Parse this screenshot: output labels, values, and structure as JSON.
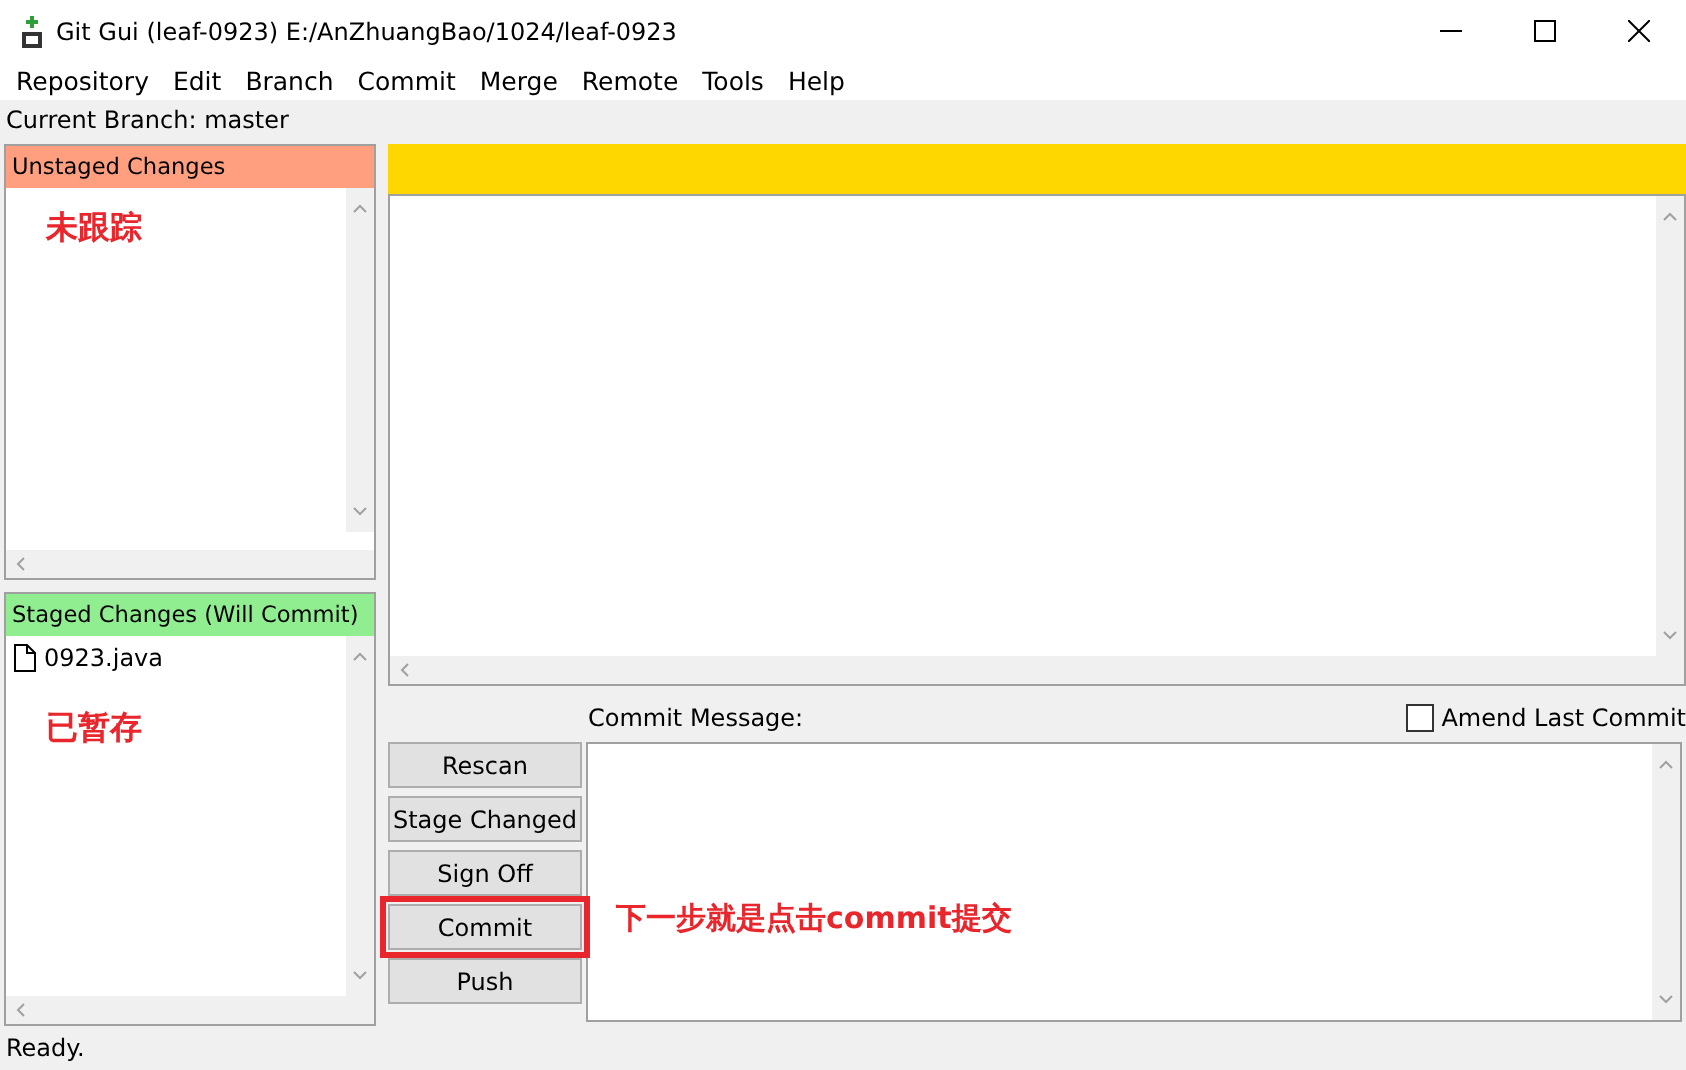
{
  "window": {
    "title": "Git Gui (leaf-0923) E:/AnZhuangBao/1024/leaf-0923"
  },
  "menu": [
    "Repository",
    "Edit",
    "Branch",
    "Commit",
    "Merge",
    "Remote",
    "Tools",
    "Help"
  ],
  "current_branch": "Current Branch: master",
  "unstaged": {
    "title": "Unstaged Changes",
    "color": "#ff9f7f",
    "note": "未跟踪"
  },
  "staged": {
    "title": "Staged Changes (Will Commit)",
    "color": "#90ee90",
    "note": "已暂存",
    "files": [
      {
        "name": "0923.java"
      }
    ]
  },
  "commit": {
    "label": "Commit Message:",
    "amend": {
      "label": "Amend Last Commit",
      "checked": false
    },
    "buttons": [
      {
        "label": "Rescan",
        "annotated": false
      },
      {
        "label": "Stage Changed",
        "annotated": false
      },
      {
        "label": "Sign Off",
        "annotated": false
      },
      {
        "label": "Commit",
        "annotated": true
      },
      {
        "label": "Push",
        "annotated": false
      }
    ],
    "note": "下一步就是点击commit提交"
  },
  "status_bar": "Ready."
}
